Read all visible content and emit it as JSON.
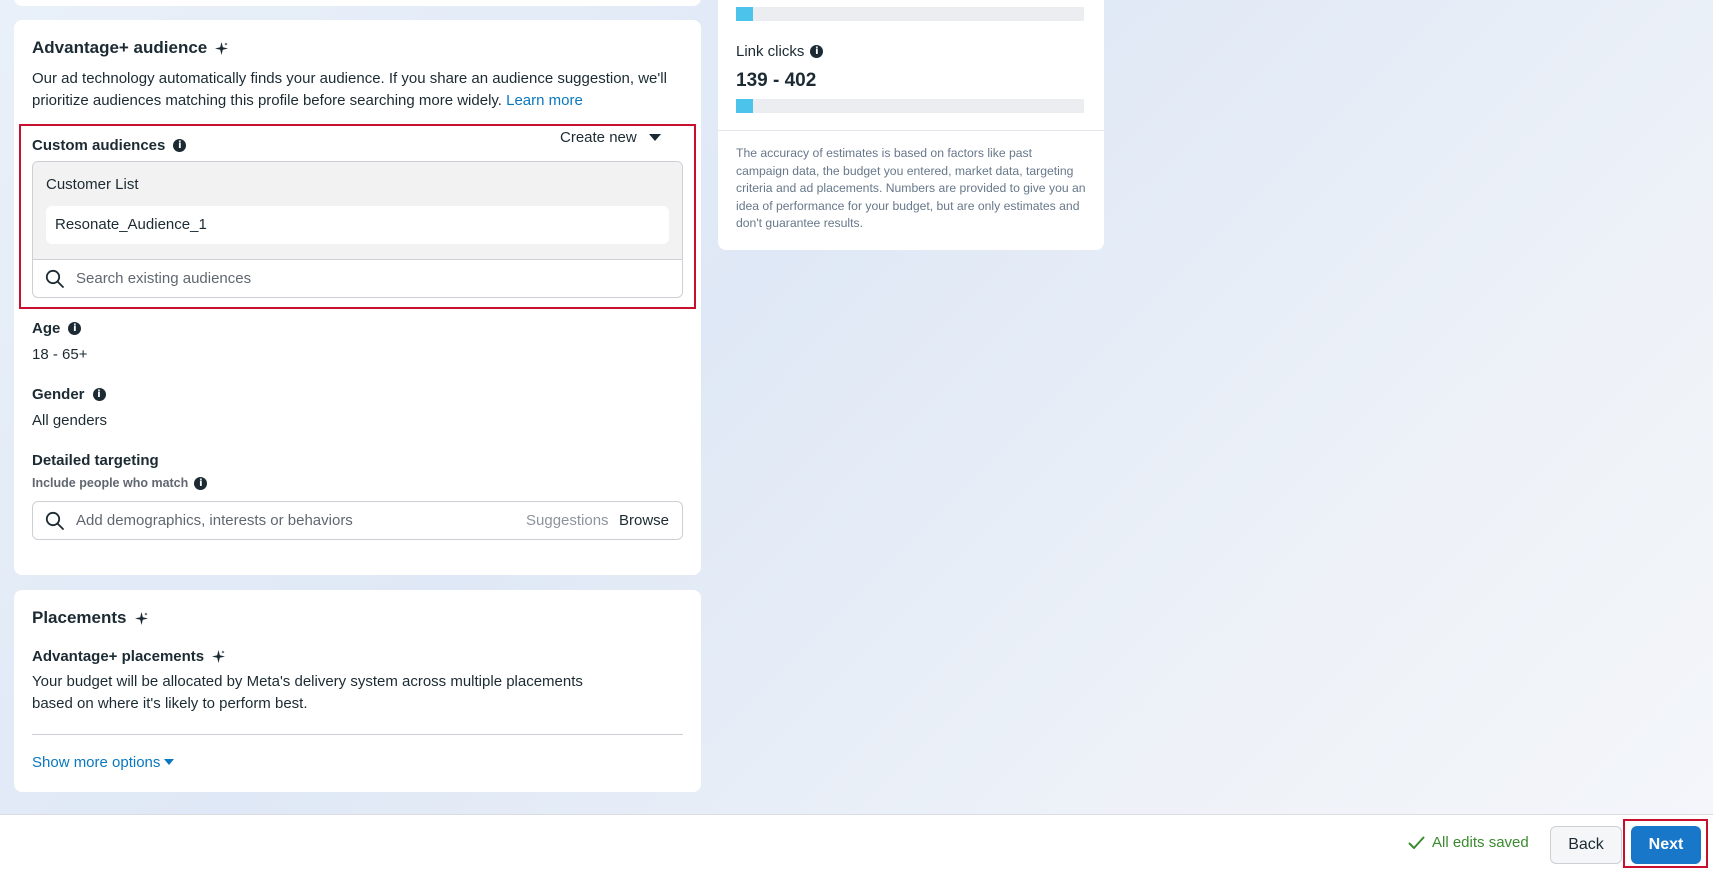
{
  "estimates": {
    "top_bar_fill_percent": 5,
    "link_clicks_label": "Link clicks",
    "link_clicks_value": "139 - 402",
    "link_clicks_fill_percent": 5,
    "disclaimer": "The accuracy of estimates is based on factors like past campaign data, the budget you entered, market data, targeting criteria and ad placements. Numbers are provided to give you an idea of performance for your budget, but are only estimates and don't guarantee results."
  },
  "audience": {
    "title": "Advantage+ audience",
    "description": "Our ad technology automatically finds your audience. If you share an audience suggestion, we'll prioritize audiences matching this profile before searching more widely.",
    "learn_more": "Learn more",
    "custom_audiences": {
      "label": "Custom audiences",
      "create_new": "Create new",
      "group_label": "Customer List",
      "selected": "Resonate_Audience_1",
      "search_placeholder": "Search existing audiences"
    },
    "age": {
      "label": "Age",
      "value": "18 - 65+"
    },
    "gender": {
      "label": "Gender",
      "value": "All genders"
    },
    "detailed_targeting": {
      "label": "Detailed targeting",
      "sub_label": "Include people who match",
      "placeholder": "Add demographics, interests or behaviors",
      "suggestions": "Suggestions",
      "browse": "Browse"
    }
  },
  "placements": {
    "title": "Placements",
    "advantage_label": "Advantage+ placements",
    "description_line1": "Your budget will be allocated by Meta's delivery system across multiple placements",
    "description_line2": "based on where it's likely to perform best.",
    "show_more": "Show more options"
  },
  "footer": {
    "saved_status": "All edits saved",
    "back": "Back",
    "next": "Next"
  },
  "colors": {
    "accent": "#0a78be",
    "next_button": "#1877c9",
    "highlight": "#c8102e",
    "success": "#3a8a2e",
    "bar_fill": "#4cc3eb"
  }
}
